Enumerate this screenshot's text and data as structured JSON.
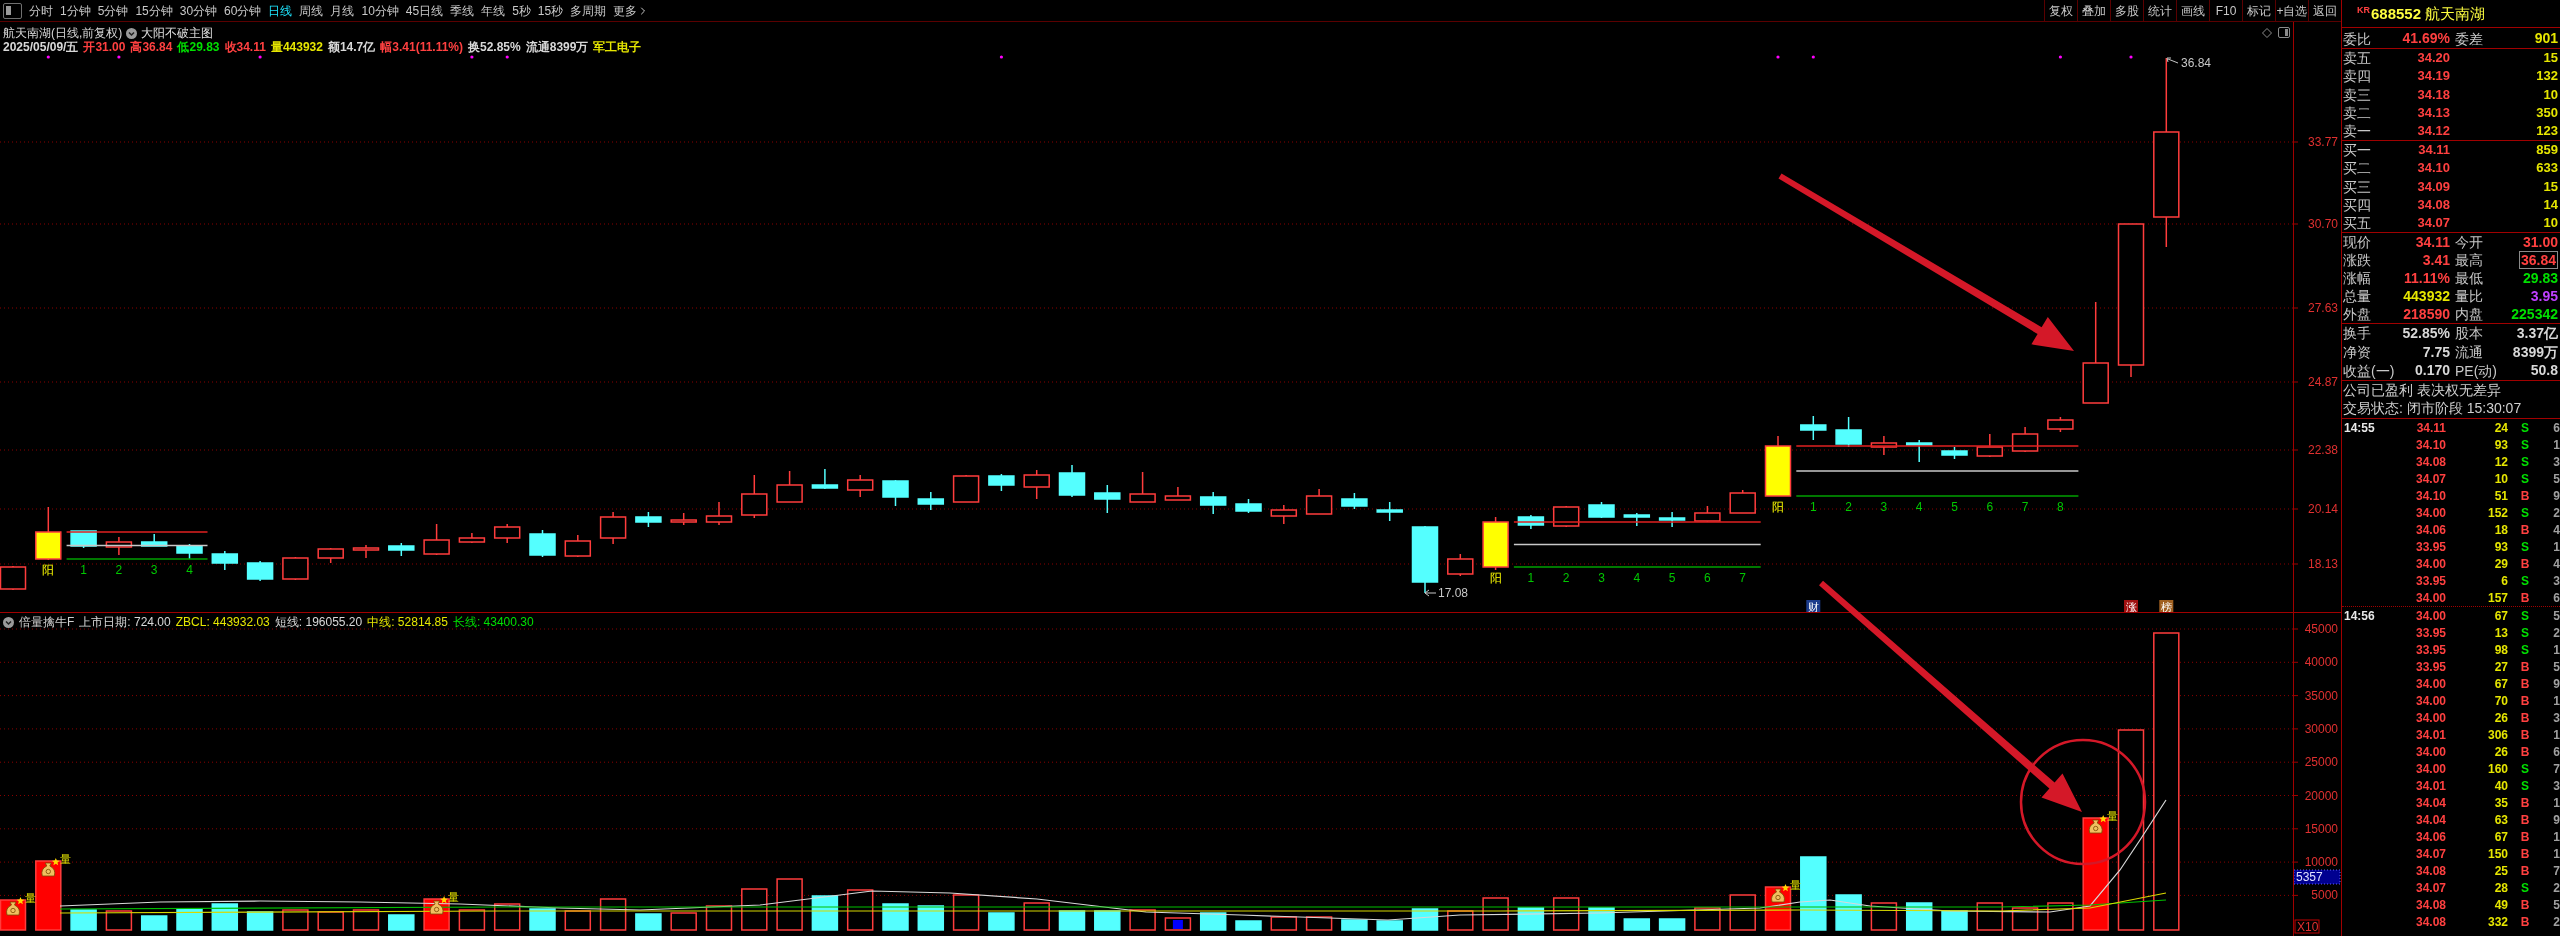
{
  "toolbar": {
    "periods": [
      {
        "label": "分时",
        "selected": false
      },
      {
        "label": "1分钟",
        "selected": false
      },
      {
        "label": "5分钟",
        "selected": false
      },
      {
        "label": "15分钟",
        "selected": false
      },
      {
        "label": "30分钟",
        "selected": false
      },
      {
        "label": "60分钟",
        "selected": false
      },
      {
        "label": "日线",
        "selected": true
      },
      {
        "label": "周线",
        "selected": false
      },
      {
        "label": "月线",
        "selected": false
      },
      {
        "label": "10分钟",
        "selected": false
      },
      {
        "label": "45日线",
        "selected": false
      },
      {
        "label": "季线",
        "selected": false
      },
      {
        "label": "年线",
        "selected": false
      },
      {
        "label": "5秒",
        "selected": false
      },
      {
        "label": "15秒",
        "selected": false
      },
      {
        "label": "多周期",
        "selected": false
      }
    ],
    "more": "更多",
    "actions": [
      "复权",
      "叠加",
      "多股",
      "统计",
      "画线",
      "F10",
      "标记",
      "+自选",
      "返回"
    ]
  },
  "main_chart": {
    "title": "航天南湖(日线,前复权)",
    "indicator": "大阳不破主图",
    "quote": [
      {
        "text": "2025/05/09/五",
        "color": "#d8d8d8"
      },
      {
        "text": "开31.00",
        "color": "#ff4040"
      },
      {
        "text": "高36.84",
        "color": "#ff4040"
      },
      {
        "text": "低29.83",
        "color": "#00e000"
      },
      {
        "text": "收34.11",
        "color": "#ff4040"
      },
      {
        "text": "量443932",
        "color": "#e6e600"
      },
      {
        "text": "额14.7亿",
        "color": "#d8d8d8"
      },
      {
        "text": "幅3.41(11.11%)",
        "color": "#ff4040"
      },
      {
        "text": "换52.85%",
        "color": "#d8d8d8"
      },
      {
        "text": "流通8399万",
        "color": "#d8d8d8"
      },
      {
        "text": "军工电子",
        "color": "#e6e600"
      }
    ],
    "price_axis": [
      "33.77",
      "30.70",
      "27.63",
      "24.87",
      "22.38",
      "20.14",
      "18.13"
    ],
    "high_label": "36.84",
    "low_label": "17.08",
    "signal_boxes": [
      {
        "label": "阳",
        "counts": [
          "1",
          "2",
          "3",
          "4"
        ]
      },
      {
        "label": "阳",
        "counts": [
          "1",
          "2",
          "3",
          "4",
          "5",
          "6",
          "7"
        ]
      },
      {
        "label": "阳",
        "counts": [
          "1",
          "2",
          "3",
          "4",
          "5",
          "6",
          "7",
          "8"
        ]
      }
    ],
    "event_tags": [
      {
        "label": "财",
        "color": "#1c3c8c"
      },
      {
        "label": "涨",
        "color": "#a01010"
      },
      {
        "label": "榜",
        "color": "#a06020"
      }
    ]
  },
  "volume_panel": {
    "name": "倍量擒牛F",
    "fields": [
      {
        "text": "上市日期: 724.00",
        "color": "#d8d8d8"
      },
      {
        "text": "ZBCL: 443932.03",
        "color": "#e6e600"
      },
      {
        "text": "短线: 196055.20",
        "color": "#d8d8d8"
      },
      {
        "text": "中线: 52814.85",
        "color": "#e6e600"
      },
      {
        "text": "长线: 43400.30",
        "color": "#00e000"
      }
    ],
    "axis": [
      "45000",
      "40000",
      "35000",
      "30000",
      "25000",
      "20000",
      "15000",
      "10000",
      "5000"
    ],
    "cursor_value": "5357",
    "scale": "X10",
    "signals": [
      "量",
      "量",
      "量",
      "量",
      "量"
    ]
  },
  "quote_panel": {
    "market": "KR",
    "code": "688552",
    "name": "航天南湖",
    "ratio": [
      {
        "label": "委比",
        "value": "41.69%",
        "color": "#ff4040"
      },
      {
        "label": "委差",
        "value": "901",
        "color": "#e6e600"
      }
    ],
    "asks": [
      {
        "label": "卖五",
        "price": "34.20",
        "volume": "15"
      },
      {
        "label": "卖四",
        "price": "34.19",
        "volume": "132"
      },
      {
        "label": "卖三",
        "price": "34.18",
        "volume": "10"
      },
      {
        "label": "卖二",
        "price": "34.13",
        "volume": "350"
      },
      {
        "label": "卖一",
        "price": "34.12",
        "volume": "123"
      }
    ],
    "bids": [
      {
        "label": "买一",
        "price": "34.11",
        "volume": "859"
      },
      {
        "label": "买二",
        "price": "34.10",
        "volume": "633"
      },
      {
        "label": "买三",
        "price": "34.09",
        "volume": "15"
      },
      {
        "label": "买四",
        "price": "34.08",
        "volume": "14"
      },
      {
        "label": "买五",
        "price": "34.07",
        "volume": "10"
      }
    ],
    "stats": [
      [
        {
          "label": "现价",
          "value": "34.11",
          "color": "#ff4040",
          "highlighted": false
        },
        {
          "label": "今开",
          "value": "31.00",
          "color": "#ff4040",
          "highlighted": false
        }
      ],
      [
        {
          "label": "涨跌",
          "value": "3.41",
          "color": "#ff4040",
          "highlighted": false
        },
        {
          "label": "最高",
          "value": "36.84",
          "color": "#ff4040",
          "highlighted": true
        }
      ],
      [
        {
          "label": "涨幅",
          "value": "11.11%",
          "color": "#ff4040",
          "highlighted": false
        },
        {
          "label": "最低",
          "value": "29.83",
          "color": "#00e000",
          "highlighted": false
        }
      ],
      [
        {
          "label": "总量",
          "value": "443932",
          "color": "#e6e600",
          "highlighted": false
        },
        {
          "label": "量比",
          "value": "3.95",
          "color": "#c040ff",
          "highlighted": false
        }
      ],
      [
        {
          "label": "外盘",
          "value": "218590",
          "color": "#ff4040",
          "highlighted": false
        },
        {
          "label": "内盘",
          "value": "225342",
          "color": "#00e000",
          "highlighted": false
        }
      ]
    ],
    "fundamentals": [
      [
        {
          "label": "换手",
          "value": "52.85%"
        },
        {
          "label": "股本",
          "value": "3.37亿"
        }
      ],
      [
        {
          "label": "净资",
          "value": "7.75"
        },
        {
          "label": "流通",
          "value": "8399万"
        }
      ],
      [
        {
          "label": "收益(一)",
          "value": "0.170"
        },
        {
          "label": "PE(动)",
          "value": "50.8"
        }
      ]
    ],
    "notes": [
      "公司已盈利 表决权无差异",
      "交易状态: 闭市阶段 15:30:07"
    ]
  },
  "trades": [
    {
      "time": "14:55",
      "rows": [
        {
          "price": "34.11",
          "volume": "24",
          "side": "S",
          "kind": "sell",
          "column_5": "6"
        },
        {
          "price": "34.10",
          "volume": "93",
          "side": "S",
          "kind": "sell",
          "column_5": "1"
        },
        {
          "price": "34.08",
          "volume": "12",
          "side": "S",
          "kind": "sell",
          "column_5": "3"
        },
        {
          "price": "34.07",
          "volume": "10",
          "side": "S",
          "kind": "sell",
          "column_5": "5"
        },
        {
          "price": "34.10",
          "volume": "51",
          "side": "B",
          "kind": "buy",
          "column_5": "9"
        },
        {
          "price": "34.00",
          "volume": "152",
          "side": "S",
          "kind": "sell",
          "column_5": "2"
        },
        {
          "price": "34.06",
          "volume": "18",
          "side": "B",
          "kind": "buy",
          "column_5": "4"
        },
        {
          "price": "33.95",
          "volume": "93",
          "side": "S",
          "kind": "sell",
          "column_5": "1"
        },
        {
          "price": "34.00",
          "volume": "29",
          "side": "B",
          "kind": "buy",
          "column_5": "4"
        },
        {
          "price": "33.95",
          "volume": "6",
          "side": "S",
          "kind": "sell",
          "column_5": "3"
        },
        {
          "price": "34.00",
          "volume": "157",
          "side": "B",
          "kind": "buy",
          "column_5": "6"
        }
      ]
    },
    {
      "time": "14:56",
      "rows": [
        {
          "price": "34.00",
          "volume": "67",
          "side": "S",
          "kind": "sell",
          "column_5": "5"
        },
        {
          "price": "33.95",
          "volume": "13",
          "side": "S",
          "kind": "sell",
          "column_5": "2"
        },
        {
          "price": "33.95",
          "volume": "98",
          "side": "S",
          "kind": "sell",
          "column_5": "1"
        },
        {
          "price": "33.95",
          "volume": "27",
          "side": "B",
          "kind": "buy",
          "column_5": "5"
        },
        {
          "price": "34.00",
          "volume": "67",
          "side": "B",
          "kind": "buy",
          "column_5": "9"
        },
        {
          "price": "34.00",
          "volume": "70",
          "side": "B",
          "kind": "buy",
          "column_5": "1"
        },
        {
          "price": "34.00",
          "volume": "26",
          "side": "B",
          "kind": "buy",
          "column_5": "3"
        },
        {
          "price": "34.01",
          "volume": "306",
          "side": "B",
          "kind": "buy",
          "column_5": "1"
        },
        {
          "price": "34.00",
          "volume": "26",
          "side": "B",
          "kind": "buy",
          "column_5": "6"
        },
        {
          "price": "34.00",
          "volume": "160",
          "side": "S",
          "kind": "sell",
          "column_5": "7"
        },
        {
          "price": "34.01",
          "volume": "40",
          "side": "S",
          "kind": "sell",
          "column_5": "3"
        },
        {
          "price": "34.04",
          "volume": "35",
          "side": "B",
          "kind": "buy",
          "column_5": "1"
        },
        {
          "price": "34.04",
          "volume": "63",
          "side": "B",
          "kind": "buy",
          "column_5": "9"
        },
        {
          "price": "34.06",
          "volume": "67",
          "side": "B",
          "kind": "buy",
          "column_5": "1"
        },
        {
          "price": "34.07",
          "volume": "150",
          "side": "B",
          "kind": "buy",
          "column_5": "1"
        },
        {
          "price": "34.08",
          "volume": "25",
          "side": "B",
          "kind": "buy",
          "column_5": "7"
        },
        {
          "price": "34.07",
          "volume": "28",
          "side": "S",
          "kind": "sell",
          "column_5": "2"
        },
        {
          "price": "34.08",
          "volume": "49",
          "side": "B",
          "kind": "buy",
          "column_5": "5"
        },
        {
          "price": "34.08",
          "volume": "332",
          "side": "B",
          "kind": "buy",
          "column_5": "2"
        }
      ]
    }
  ]
}
